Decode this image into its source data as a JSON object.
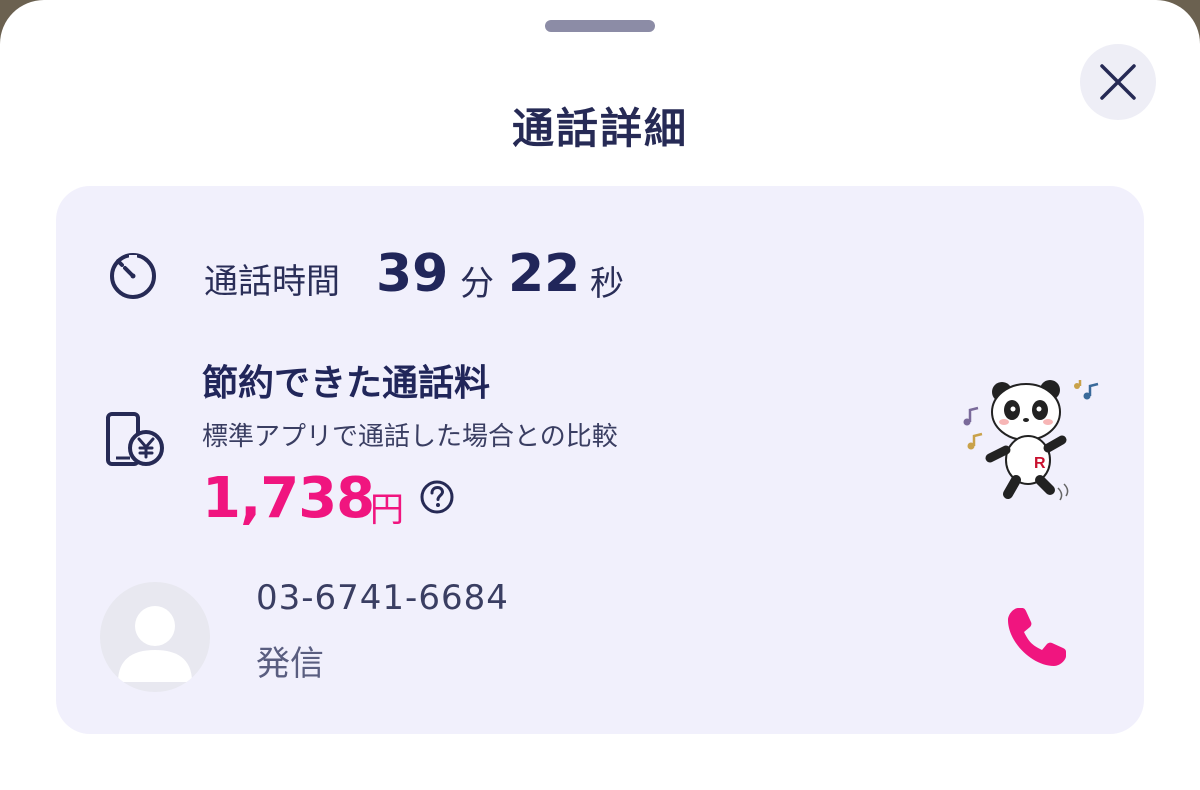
{
  "sheet": {
    "title": "通話詳細"
  },
  "duration": {
    "label": "通話時間",
    "minutes": "39",
    "minutes_unit": "分",
    "seconds": "22",
    "seconds_unit": "秒"
  },
  "savings": {
    "title": "節約できた通話料",
    "subtitle": "標準アプリで通話した場合との比較",
    "amount": "1,738",
    "unit": "円"
  },
  "contact": {
    "phone_number": "03-6741-6684",
    "direction": "発信"
  },
  "icons": {
    "close": "close-icon",
    "timer": "timer-icon",
    "phone_yen": "phone-yen-icon",
    "help": "help-icon",
    "avatar": "person-icon",
    "call": "phone-icon"
  },
  "colors": {
    "accent": "#f0157f",
    "navy": "#21265a",
    "card_bg": "#f1f0fc"
  }
}
